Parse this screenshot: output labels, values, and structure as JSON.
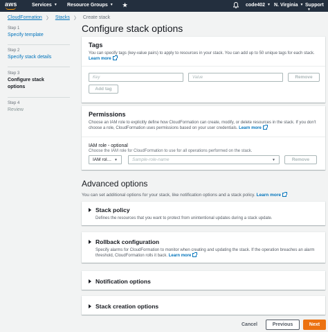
{
  "nav": {
    "logo": "aws",
    "services": "Services",
    "resource_groups": "Resource Groups",
    "pin_icon": "star-icon",
    "bell_icon": "bell-icon",
    "user": "code402",
    "region": "N. Virginia",
    "support": "Support"
  },
  "breadcrumb": {
    "items": [
      "CloudFormation",
      "Stacks",
      "Create stack"
    ]
  },
  "steps": [
    {
      "num": "Step 1",
      "title": "Specify template",
      "state": "link"
    },
    {
      "num": "Step 2",
      "title": "Specify stack details",
      "state": "link"
    },
    {
      "num": "Step 3",
      "title": "Configure stack options",
      "state": "active"
    },
    {
      "num": "Step 4",
      "title": "Review",
      "state": "disabled"
    }
  ],
  "page_title": "Configure stack options",
  "tags": {
    "title": "Tags",
    "desc": "You can specify tags (key-value pairs) to apply to resources in your stack. You can add up to 50 unique tags for each stack.",
    "learn_more": "Learn more",
    "key_placeholder": "Key",
    "value_placeholder": "Value",
    "remove": "Remove",
    "add_tag": "Add tag"
  },
  "permissions": {
    "title": "Permissions",
    "desc": "Choose an IAM role to explicitly define how CloudFormation can create, modify, or delete resources in the stack. If you don't choose a role, CloudFormation uses permissions based on your user credentials.",
    "learn_more": "Learn more",
    "iam_label": "IAM role - optional",
    "iam_hint": "Choose the IAM role for CloudFormation to use for all operations performed on the stack.",
    "iam_select": "IAM rol…",
    "role_placeholder": "Sample-role-name",
    "remove": "Remove"
  },
  "advanced": {
    "title": "Advanced options",
    "desc": "You can set additional options for your stack, like notification options and a stack policy.",
    "learn_more": "Learn more",
    "sections": [
      {
        "title": "Stack policy",
        "desc": "Defines the resources that you want to protect from unintentional updates during a stack update."
      },
      {
        "title": "Rollback configuration",
        "desc": "Specify alarms for CloudFormation to monitor when creating and updating the stack. If the operation breaches an alarm threshold, CloudFormation rolls it back.",
        "learn_more": "Learn more"
      },
      {
        "title": "Notification options"
      },
      {
        "title": "Stack creation options"
      }
    ]
  },
  "footer": {
    "cancel": "Cancel",
    "previous": "Previous",
    "next": "Next"
  },
  "colors": {
    "nav_bg": "#232f3e",
    "link": "#0073bb",
    "primary": "#ec7211"
  }
}
